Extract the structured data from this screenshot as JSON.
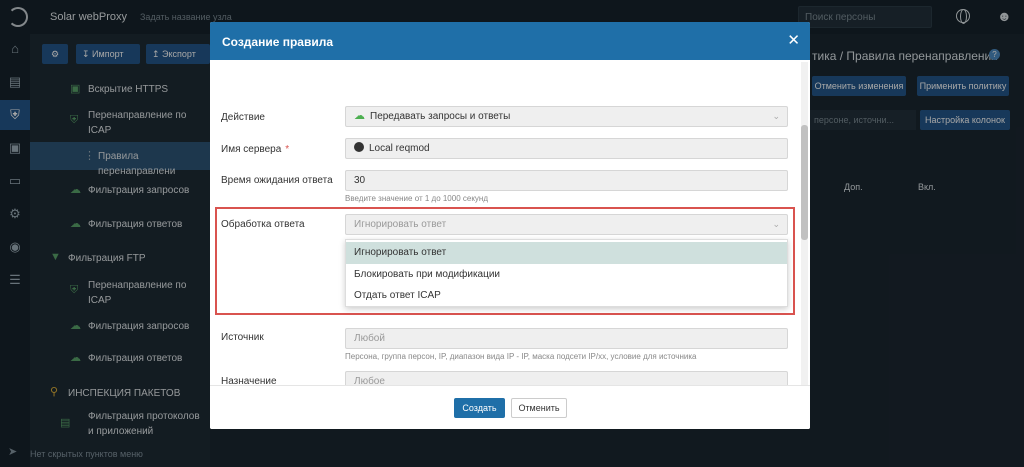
{
  "app": {
    "title": "Solar webProxy",
    "node_placeholder": "Задать название узла",
    "search_placeholder": "Поиск персоны"
  },
  "sidebar": {
    "import_label": "Импорт",
    "export_label": "Экспорт",
    "items": [
      {
        "label": "Вскрытие HTTPS"
      },
      {
        "label": "Перенаправление по ICAP"
      },
      {
        "label": "Правила перенаправлени"
      },
      {
        "label": "Фильтрация запросов"
      },
      {
        "label": "Фильтрация ответов"
      },
      {
        "label": "Фильтрация FTP"
      },
      {
        "label": "Перенаправление по ICAP"
      },
      {
        "label": "Фильтрация запросов"
      },
      {
        "label": "Фильтрация ответов"
      },
      {
        "label": "ИНСПЕКЦИЯ ПАКЕТОВ"
      },
      {
        "label": "Фильтрация протоколов и приложений"
      }
    ],
    "hidden_note": "Нет скрытых пунктов меню"
  },
  "background": {
    "breadcrumb": "тика / Правила перенаправления",
    "cancel_changes": "Отменить изменения",
    "apply_policy": "Применить политику",
    "search_placeholder": "персоне, источни...",
    "columns_btn": "Настройка колонок",
    "col_extra": "Доп.",
    "col_enabled": "Вкл."
  },
  "modal": {
    "title": "Создание правила",
    "action_label": "Действие",
    "action_value": "Передавать запросы и ответы",
    "server_label": "Имя сервера",
    "server_value": "Local reqmod",
    "timeout_label": "Время ожидания ответа",
    "timeout_value": "30",
    "timeout_hint": "Введите значение от 1 до 1000 секунд",
    "response_label": "Обработка ответа",
    "response_value": "Игнорировать ответ",
    "response_options": [
      "Игнорировать ответ",
      "Блокировать при модификации",
      "Отдать ответ ICAP"
    ],
    "source_label": "Источник",
    "source_placeholder": "Любой",
    "source_hint": "Персона, группа персон, IP, диапазон вида IP - IP, маска подсети IP/xx, условие для источника",
    "dest_label": "Назначение",
    "dest_placeholder": "Любое",
    "create_btn": "Создать",
    "cancel_btn": "Отменить"
  }
}
